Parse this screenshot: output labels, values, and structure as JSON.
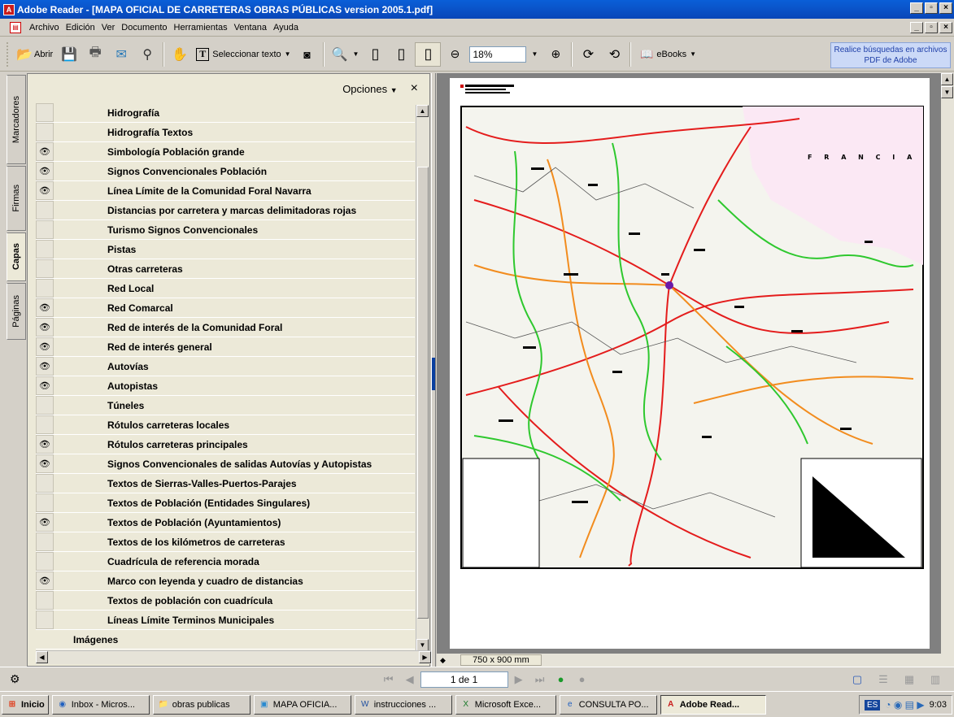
{
  "window": {
    "title": "Adobe Reader - [MAPA OFICIAL DE CARRETERAS OBRAS PÚBLICAS version 2005.1.pdf]"
  },
  "menu": [
    "Archivo",
    "Edición",
    "Ver",
    "Documento",
    "Herramientas",
    "Ventana",
    "Ayuda"
  ],
  "toolbar": {
    "open_label": "Abrir",
    "select_text_label": "Seleccionar texto",
    "zoom_value": "18%",
    "ebooks_label": "eBooks",
    "search_ad": "Realice búsquedas en archivos PDF de Adobe"
  },
  "side_tabs": [
    "Marcadores",
    "Firmas",
    "Capas",
    "Páginas"
  ],
  "panel": {
    "options_label": "Opciones",
    "close_glyph": "×",
    "layers": [
      {
        "name": "Hidrografía",
        "visible": false
      },
      {
        "name": "Hidrografía Textos",
        "visible": false
      },
      {
        "name": "Simbología Población grande",
        "visible": true
      },
      {
        "name": "Signos Convencionales Población",
        "visible": true
      },
      {
        "name": "Línea Límite de la Comunidad Foral Navarra",
        "visible": true
      },
      {
        "name": "Distancias por carretera y marcas delimitadoras rojas",
        "visible": false
      },
      {
        "name": "Turismo Signos Convencionales",
        "visible": false
      },
      {
        "name": "Pistas",
        "visible": false
      },
      {
        "name": "Otras carreteras",
        "visible": false
      },
      {
        "name": "Red Local",
        "visible": false
      },
      {
        "name": "Red Comarcal",
        "visible": true
      },
      {
        "name": "Red de interés de la Comunidad Foral",
        "visible": true
      },
      {
        "name": "Red de interés general",
        "visible": true
      },
      {
        "name": "Autovías",
        "visible": true
      },
      {
        "name": "Autopistas",
        "visible": true
      },
      {
        "name": "Túneles",
        "visible": false
      },
      {
        "name": "Rótulos carreteras locales",
        "visible": false
      },
      {
        "name": "Rótulos carreteras principales",
        "visible": true
      },
      {
        "name": "Signos Convencionales de salidas Autovías y Autopistas",
        "visible": true
      },
      {
        "name": "Textos de Sierras-Valles-Puertos-Parajes",
        "visible": false
      },
      {
        "name": "Textos de Población (Entidades Singulares)",
        "visible": false
      },
      {
        "name": "Textos de Población (Ayuntamientos)",
        "visible": true
      },
      {
        "name": "Textos de los kilómetros de carreteras",
        "visible": false
      },
      {
        "name": "Cuadrícula de referencia morada",
        "visible": false
      },
      {
        "name": "Marco con leyenda y cuadro de distancias",
        "visible": true
      },
      {
        "name": "Textos de población con cuadrícula",
        "visible": false
      },
      {
        "name": "Líneas Límite Terminos Municipales",
        "visible": false
      },
      {
        "name": "Imágenes",
        "visible": false,
        "group": true
      }
    ]
  },
  "document": {
    "page_size": "750 x 900 mm",
    "map_label_country": "F R A N C I A"
  },
  "navigation": {
    "page_indicator": "1 de 1"
  },
  "taskbar": {
    "start_label": "Inicio",
    "tasks": [
      "Inbox - Micros...",
      "obras publicas",
      "MAPA OFICIA...",
      "instrucciones ...",
      "Microsoft Exce...",
      "CONSULTA PO...",
      "Adobe Read..."
    ],
    "language": "ES",
    "clock": "9:03"
  },
  "colors": {
    "titlebar": "#0a5fd8",
    "accent": "#c91d1d"
  }
}
